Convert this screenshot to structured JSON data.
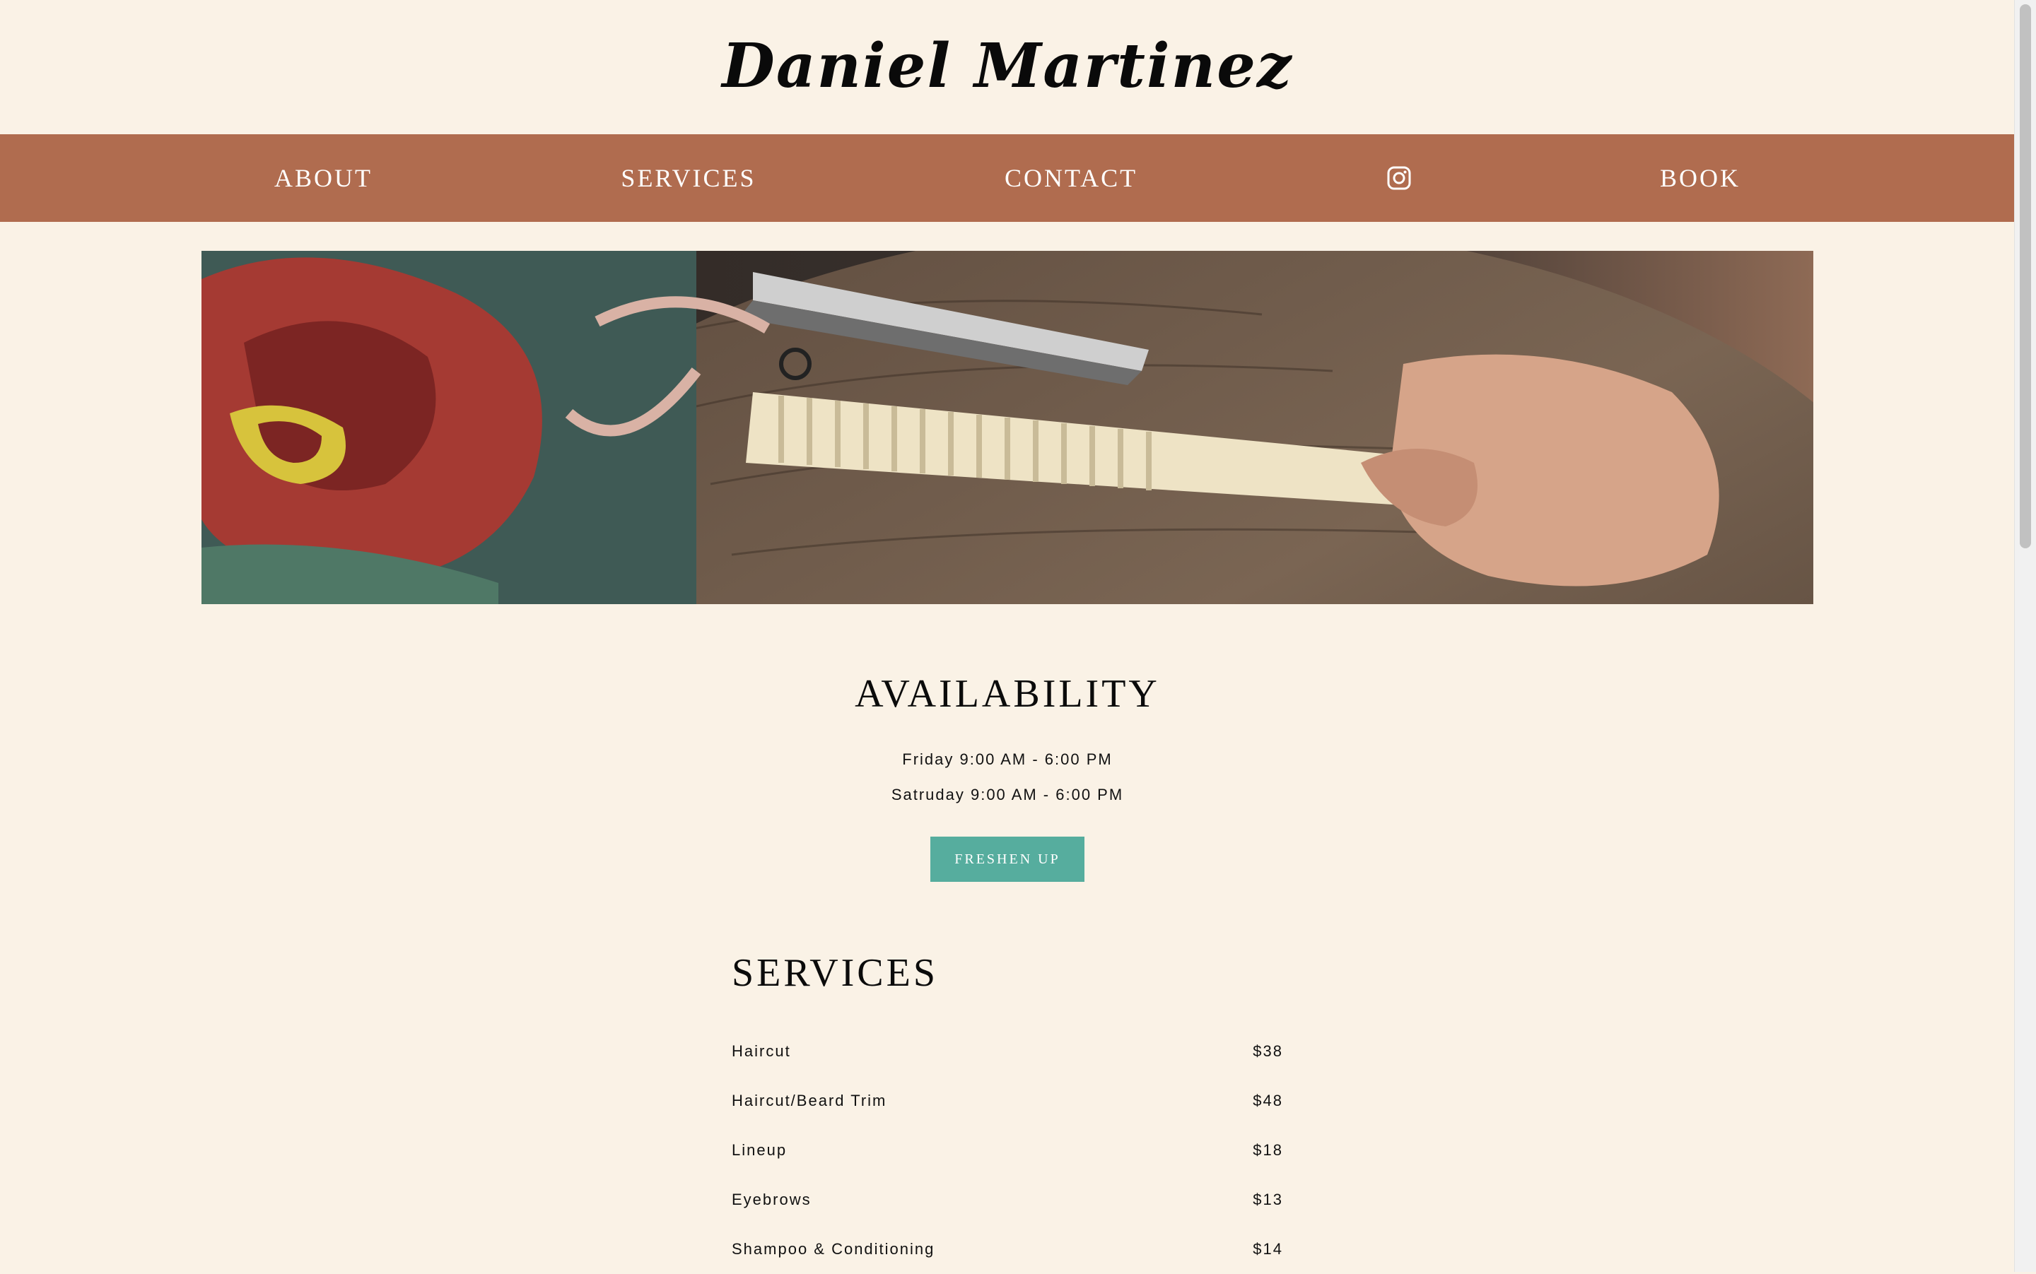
{
  "header": {
    "title": "Daniel Martinez"
  },
  "nav": {
    "items": [
      {
        "label": "ABOUT"
      },
      {
        "label": "SERVICES"
      },
      {
        "label": "CONTACT"
      },
      {
        "icon": "instagram-icon"
      },
      {
        "label": "BOOK"
      }
    ]
  },
  "hero": {
    "image": "barber-scissors-comb-haircut-photo"
  },
  "availability": {
    "title": "AVAILABILITY",
    "hours": [
      "Friday 9:00 AM - 6:00 PM",
      "Satruday 9:00 AM - 6:00 PM"
    ],
    "cta": "FRESHEN UP"
  },
  "services": {
    "title": "SERVICES",
    "items": [
      {
        "name": "Haircut",
        "price": "$38"
      },
      {
        "name": "Haircut/Beard Trim",
        "price": "$48"
      },
      {
        "name": "Lineup",
        "price": "$18"
      },
      {
        "name": "Eyebrows",
        "price": "$13"
      },
      {
        "name": "Shampoo & Conditioning",
        "price": "$14"
      }
    ]
  },
  "colors": {
    "background": "#faf2e6",
    "nav": "#b06c4f",
    "accent": "#56ad9e"
  }
}
